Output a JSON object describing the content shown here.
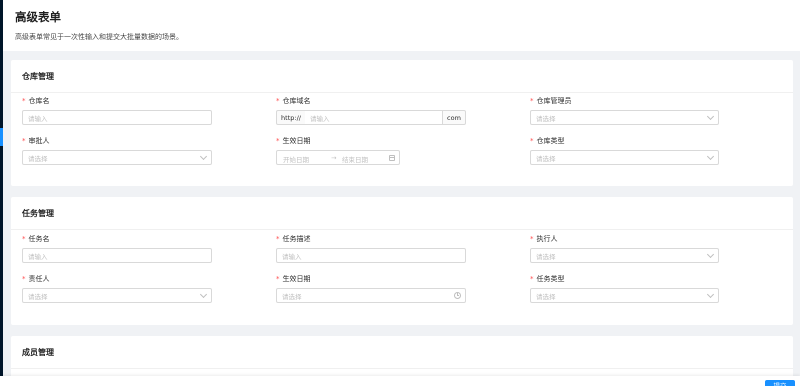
{
  "page": {
    "title": "高级表单",
    "description": "高级表单常见于一次性输入和提交大批量数据的场景。"
  },
  "colors": {
    "primary": "#1890ff",
    "required": "#ff4d4f",
    "sider": "#001529"
  },
  "warehouse": {
    "title": "仓库管理",
    "name": {
      "label": "仓库名",
      "placeholder": "请输入"
    },
    "domain": {
      "label": "仓库域名",
      "prefix": "http://",
      "placeholder": "请输入",
      "suffix": "com"
    },
    "admin": {
      "label": "仓库管理员",
      "placeholder": "请选择"
    },
    "approver": {
      "label": "审批人",
      "placeholder": "请选择"
    },
    "dateRange": {
      "label": "生效日期",
      "start": "开始日期",
      "separator": "→",
      "end": "结束日期"
    },
    "type": {
      "label": "仓库类型",
      "placeholder": "请选择"
    }
  },
  "task": {
    "title": "任务管理",
    "name": {
      "label": "任务名",
      "placeholder": "请输入"
    },
    "description": {
      "label": "任务描述",
      "placeholder": "请输入"
    },
    "executor": {
      "label": "执行人",
      "placeholder": "请选择"
    },
    "owner": {
      "label": "责任人",
      "placeholder": "请选择"
    },
    "date": {
      "label": "生效日期",
      "placeholder": "请选择"
    },
    "type": {
      "label": "任务类型",
      "placeholder": "请选择"
    }
  },
  "member": {
    "title": "成员管理"
  },
  "footer": {
    "submit_label": "提交"
  }
}
